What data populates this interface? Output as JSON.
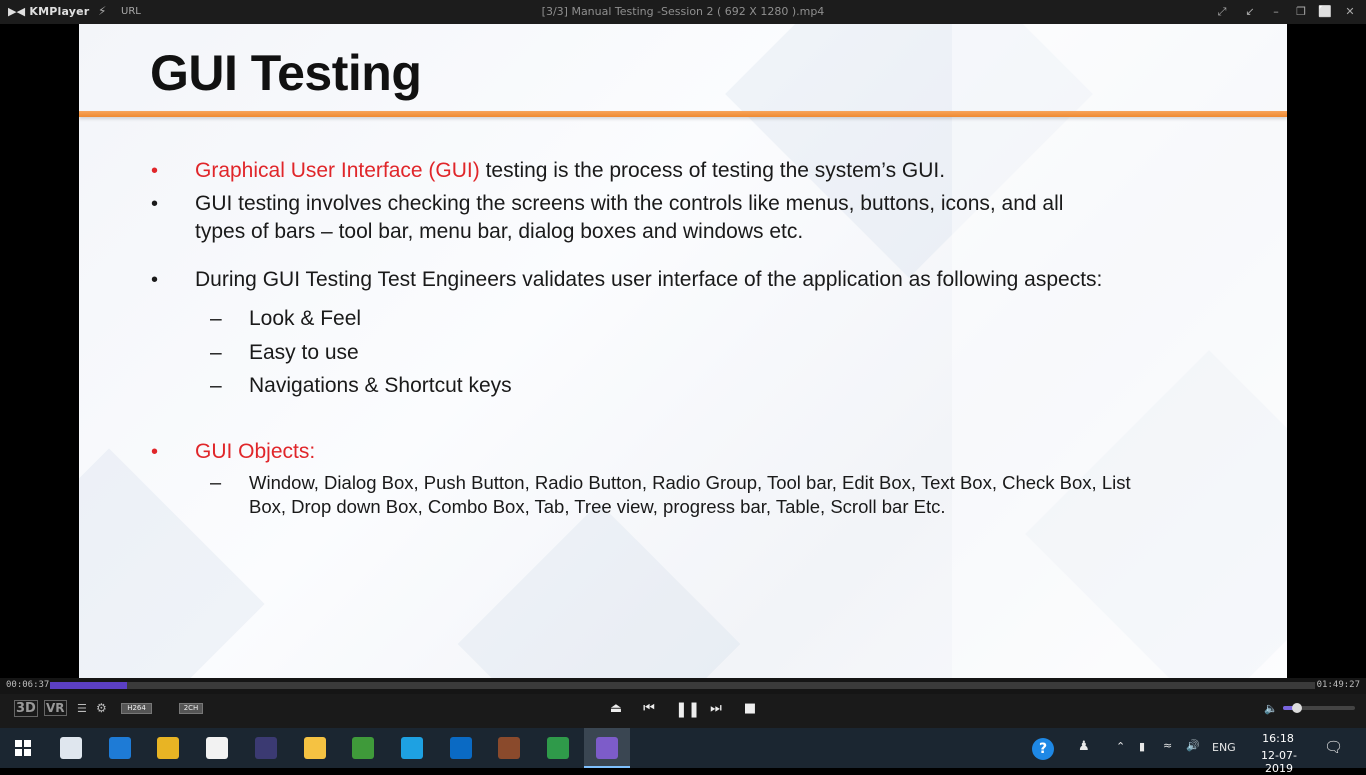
{
  "player": {
    "brand": "KMPlayer",
    "url_label": "URL",
    "window_title": "[3/3] Manual Testing -Session 2 ( 692 X 1280 ).mp4"
  },
  "slide": {
    "title": "GUI Testing",
    "bullet1_red": "Graphical User Interface (GUI)",
    "bullet1_rest": " testing is the process of testing the system’s GUI.",
    "bullet2_line1": "GUI testing involves checking the screens with the controls like menus, buttons, icons, and all",
    "bullet2_line2": "types of bars – tool bar, menu bar, dialog boxes and windows etc.",
    "bullet3": "During GUI Testing Test Engineers validates user interface of the application as following aspects:",
    "aspects": [
      "Look & Feel",
      "Easy to use",
      "Navigations & Shortcut keys"
    ],
    "bullet4_red": "GUI Objects:",
    "objects_line1": "Window, Dialog Box, Push Button, Radio Button, Radio Group, Tool bar, Edit Box, Text Box, Check Box, List",
    "objects_line2": "Box, Drop down Box, Combo Box, Tab, Tree view, progress bar, Table, Scroll bar Etc.",
    "bullet_glyph": "•",
    "dash_glyph": "–"
  },
  "playback": {
    "elapsed": "00:06:37",
    "total": "01:49:27",
    "progress_fraction": 0.0605,
    "volume_fraction": 0.15,
    "labels": {
      "three_d": "3D",
      "vr": "VR",
      "codec": "H264",
      "channels": "2CH"
    }
  },
  "taskbar": {
    "apps": [
      {
        "name": "task-view",
        "color": "#dfe6ee"
      },
      {
        "name": "edge",
        "color": "#1e7bd6"
      },
      {
        "name": "chrome",
        "color": "#e8b424"
      },
      {
        "name": "file",
        "color": "#f2f2f2"
      },
      {
        "name": "eclipse",
        "color": "#3b3a72"
      },
      {
        "name": "file-explorer",
        "color": "#f5c242"
      },
      {
        "name": "klite",
        "color": "#3f9a3a"
      },
      {
        "name": "skype",
        "color": "#1ea1e2"
      },
      {
        "name": "outlook",
        "color": "#0a6ac4"
      },
      {
        "name": "mozilla-app",
        "color": "#8a4a2c"
      },
      {
        "name": "kmplayer-k",
        "color": "#2f9a4a"
      },
      {
        "name": "visual-studio",
        "color": "#7d5cc9"
      }
    ],
    "lang": "ENG",
    "time": "16:18",
    "date": "12-07-2019"
  },
  "colors": {
    "accent_orange": "#ef8a30",
    "red_text": "#e0262a",
    "seek_fill": "#5b3fc4"
  }
}
